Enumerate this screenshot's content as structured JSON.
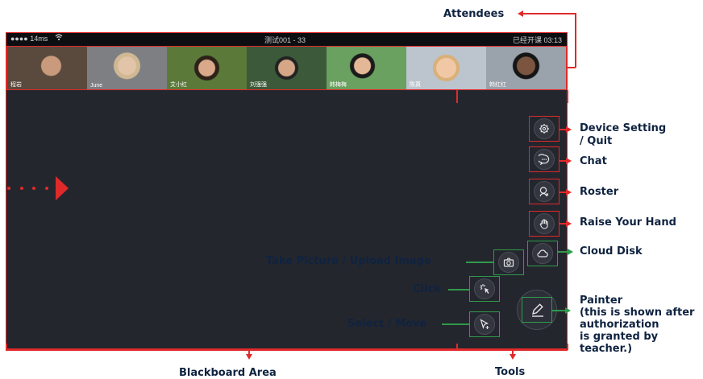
{
  "status_bar": {
    "signal": "●●●● 14ms",
    "title": "测试001 - 33",
    "class_status": "已经开课 03:13"
  },
  "attendees": [
    {
      "name": "程岩",
      "bg": "#5a4a3e"
    },
    {
      "name": "June",
      "bg": "#7e7f83"
    },
    {
      "name": "艾小红",
      "bg": "#5b7a3a"
    },
    {
      "name": "刘强强",
      "bg": "#3c5a3a"
    },
    {
      "name": "韩梅梅",
      "bg": "#6aa060"
    },
    {
      "name": "陈真",
      "bg": "#bcc4ce"
    },
    {
      "name": "韩红红",
      "bg": "#9aa2ab"
    }
  ],
  "labels": {
    "attendees": "Attendees",
    "device_setting": "Device Setting\n/ Quit",
    "chat": "Chat",
    "roster": "Roster",
    "raise_hand": "Raise Your Hand",
    "cloud_disk": "Cloud Disk",
    "take_picture": "Take Picture / Upload Image",
    "click": "Click",
    "select_move": "Select / Move",
    "painter": "Painter\n(this is shown after\nauthorization\nis granted by\nteacher.)",
    "blackboard": "Blackboard Area",
    "tools": "Tools"
  },
  "icons": {
    "settings": "gear-icon",
    "chat": "chat-bubble-icon",
    "roster": "roster-icon",
    "raise_hand": "hand-icon",
    "cloud": "cloud-icon",
    "camera": "camera-icon",
    "click": "click-cursor-icon",
    "select": "select-cursor-icon",
    "painter": "pen-icon"
  },
  "colors": {
    "annotation_red": "#e02a2a",
    "annotation_green": "#2f9a4a",
    "label_navy": "#0f2340",
    "screen_bg": "#24262e"
  }
}
